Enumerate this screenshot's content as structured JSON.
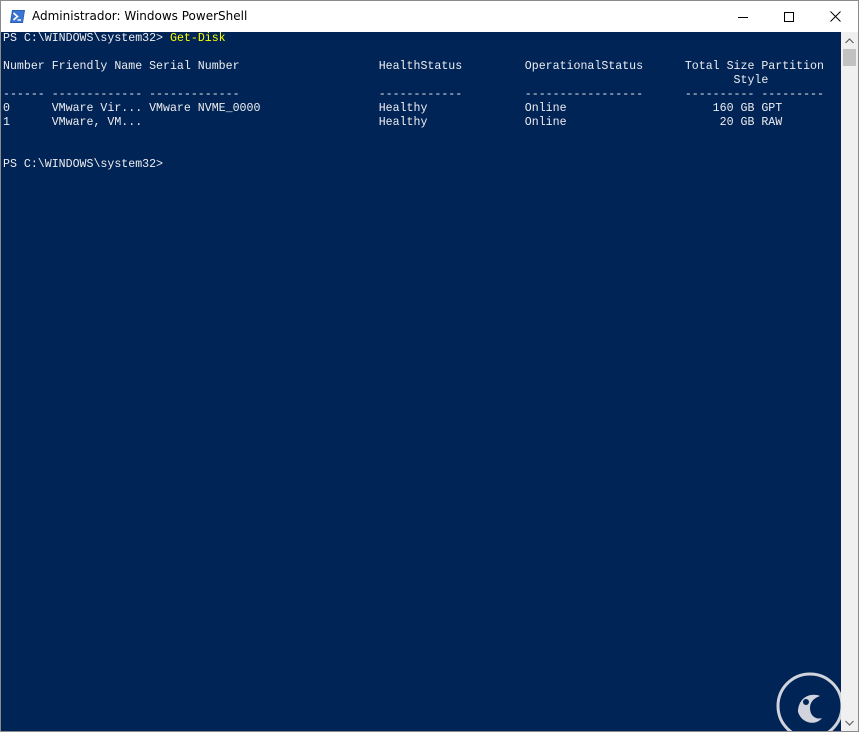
{
  "window": {
    "title": "Administrador: Windows PowerShell",
    "icon": "powershell-icon",
    "controls": [
      "minimize-icon",
      "maximize-icon",
      "close-icon"
    ]
  },
  "console": {
    "background": "#012456",
    "foreground": "#eeedf0",
    "command_color": "#ffff00",
    "prompt": "PS C:\\WINDOWS\\system32> ",
    "command": "Get-Disk",
    "blank_1": "",
    "header_1": "Number Friendly Name Serial Number                    HealthStatus         OperationalStatus      Total Size Partition",
    "header_2": "                                                                                                         Style",
    "separator": "------ ------------- -------------                    ------------         -----------------      ---------- ---------",
    "table": {
      "columns": [
        "Number",
        "Friendly Name",
        "Serial Number",
        "HealthStatus",
        "OperationalStatus",
        "Total Size",
        "Partition Style"
      ],
      "rows": [
        {
          "line": "0      VMware Vir... VMware NVME_0000                 Healthy              Online                     160 GB GPT",
          "cells": [
            "0",
            "VMware Vir...",
            "VMware NVME_0000",
            "Healthy",
            "Online",
            "160 GB",
            "GPT"
          ]
        },
        {
          "line": "1      VMware, VM...                                  Healthy              Online                      20 GB RAW",
          "cells": [
            "1",
            "VMware, VM...",
            "",
            "Healthy",
            "Online",
            "20 GB",
            "RAW"
          ]
        }
      ]
    },
    "blank_2": "",
    "blank_3": "",
    "final_prompt": "PS C:\\WINDOWS\\system32> "
  },
  "scrollbar": {
    "up_icon": "scroll-up-arrow-icon",
    "down_icon": "scroll-down-arrow-icon"
  },
  "watermark": {
    "icon": "watermark-logo-icon",
    "color": "#e8e8ec"
  }
}
